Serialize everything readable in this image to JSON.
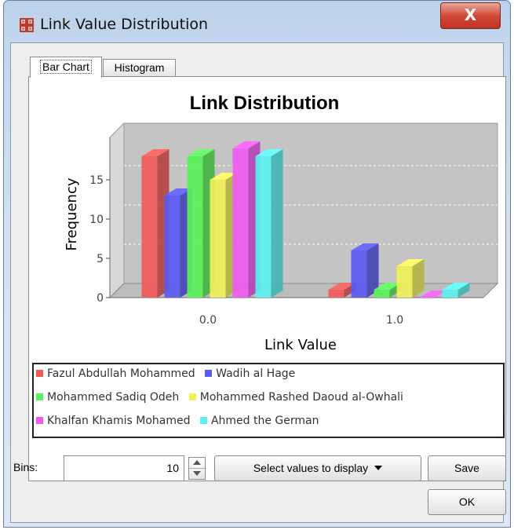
{
  "window": {
    "title": "Link Value Distribution",
    "close_glyph": "X",
    "icon": "network-grid-icon"
  },
  "tabs": [
    {
      "label": "Bar Chart",
      "active": true
    },
    {
      "label": "Histogram",
      "active": false
    }
  ],
  "chart_data": {
    "type": "bar",
    "title": "Link Distribution",
    "xlabel": "Link Value",
    "ylabel": "Frequency",
    "categories": [
      "0.0",
      "1.0"
    ],
    "y_ticks": [
      "0",
      "5",
      "10",
      "15"
    ],
    "ylim": [
      0,
      20
    ],
    "grid": true,
    "three_d": true,
    "legend_position": "bottom",
    "series": [
      {
        "name": "Fazul Abdullah Mohammed",
        "color": "#f05a5a",
        "values": [
          18,
          1
        ]
      },
      {
        "name": "Wadih al Hage",
        "color": "#5a5af0",
        "values": [
          13,
          6
        ]
      },
      {
        "name": "Mohammed Sadiq Odeh",
        "color": "#5af05a",
        "values": [
          18,
          1
        ]
      },
      {
        "name": "Mohammed Rashed Daoud al-Owhali",
        "color": "#f0f05a",
        "values": [
          15,
          4
        ]
      },
      {
        "name": "Khalfan Khamis Mohamed",
        "color": "#f05af0",
        "values": [
          19,
          0
        ]
      },
      {
        "name": "Ahmed the German",
        "color": "#5af0f0",
        "values": [
          18,
          1
        ]
      }
    ]
  },
  "controls": {
    "bins_label": "Bins:",
    "bins_value": "10",
    "select_label": "Select values to display",
    "save_label": "Save",
    "ok_label": "OK"
  }
}
